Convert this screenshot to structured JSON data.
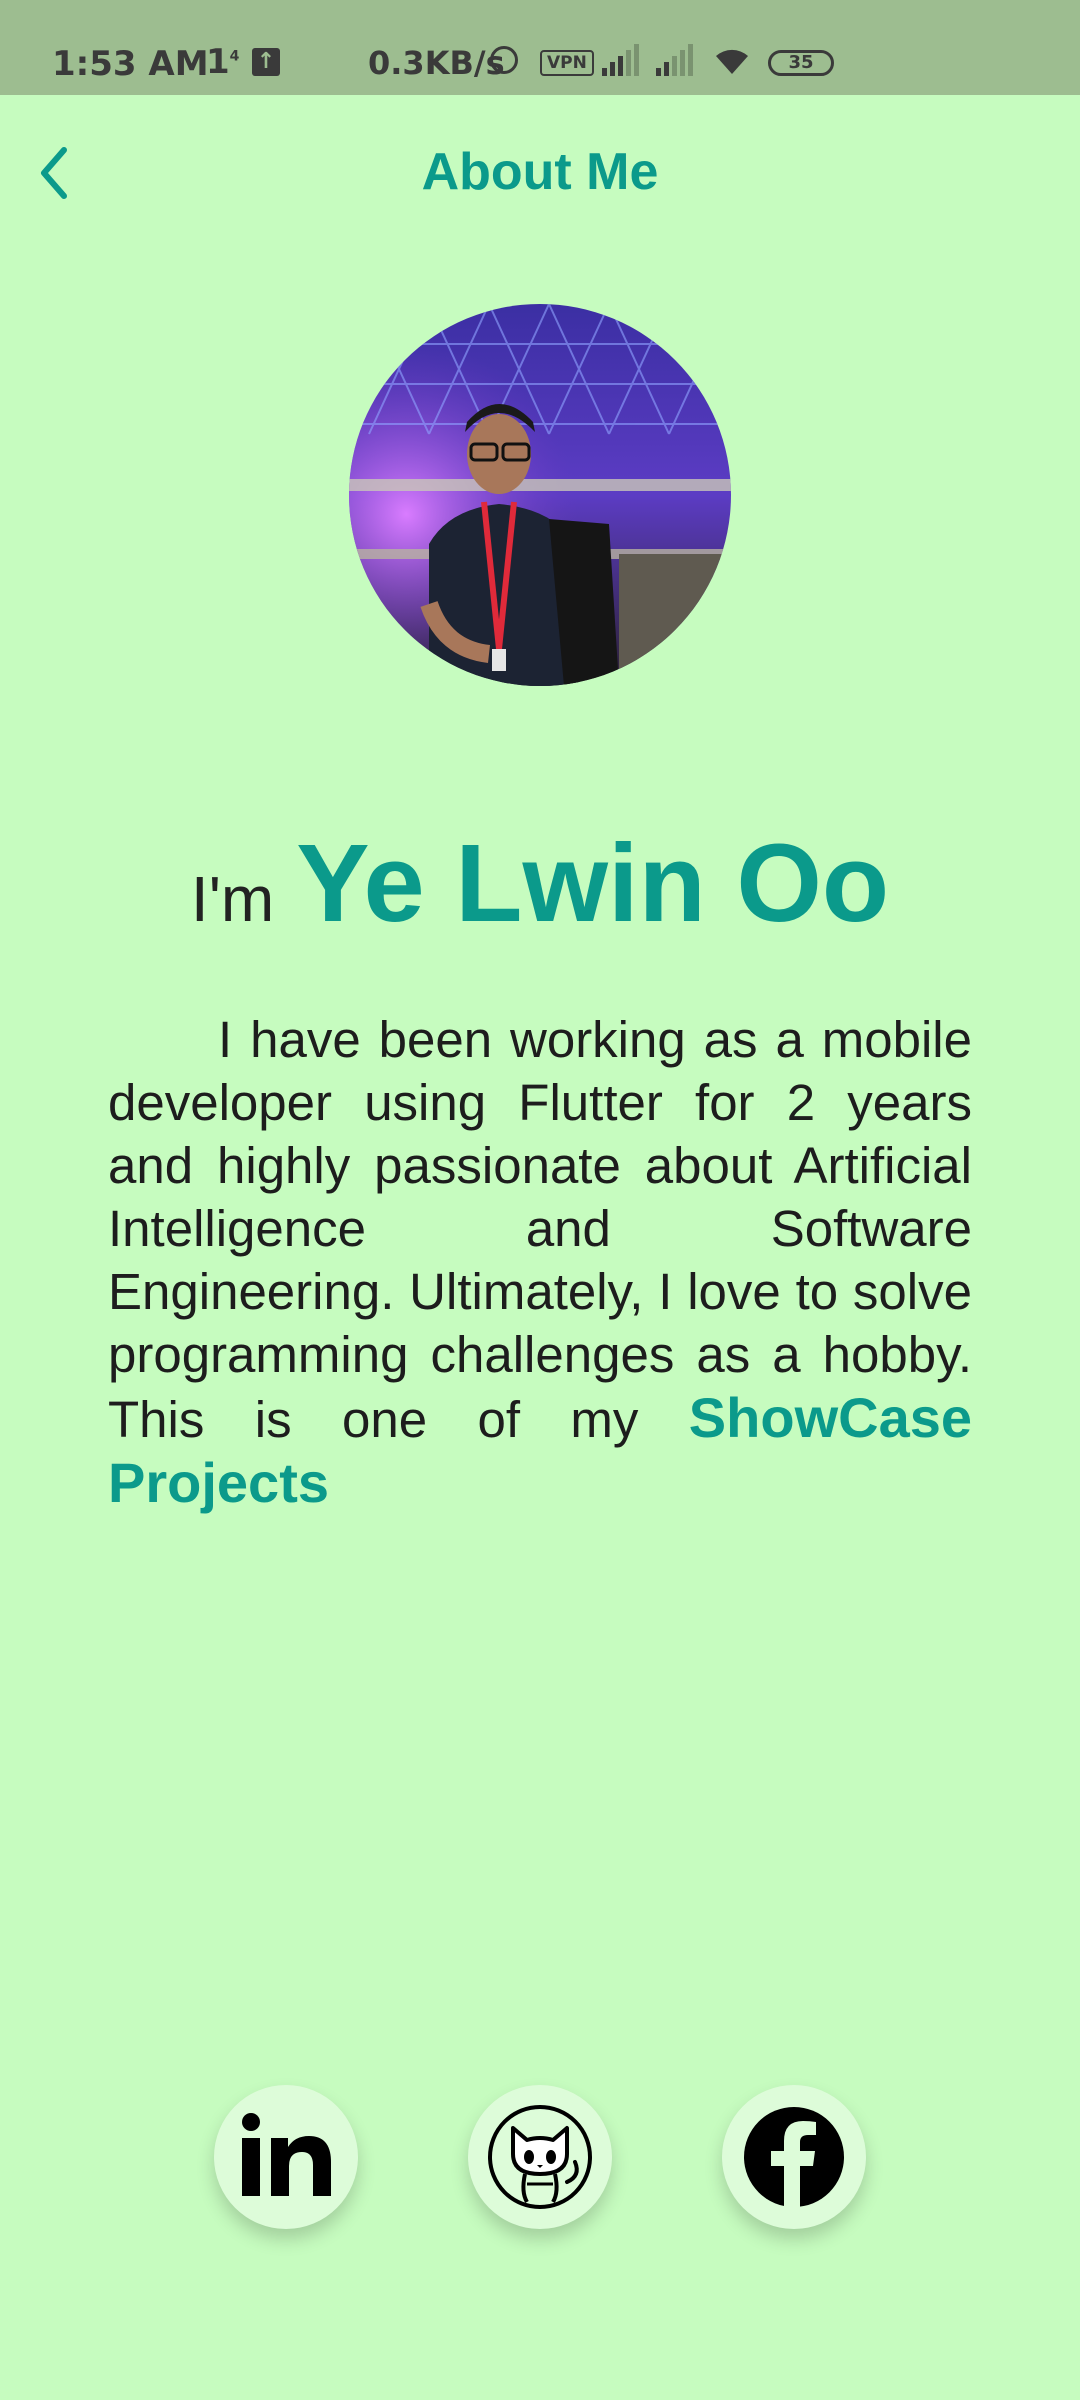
{
  "status_bar": {
    "time": "1:53 AM",
    "sim": "1",
    "sim_sup": "4",
    "network_speed": "0.3KB/s",
    "vpn_label": "VPN",
    "battery": "35"
  },
  "app_bar": {
    "title": "About Me",
    "back_icon": "chevron-left-icon"
  },
  "profile": {
    "greeting": "I'm",
    "name": "Ye Lwin Oo",
    "bio": "I have been working as a mobile developer using Flutter for 2 years and highly passionate about Artificial Intelligence and Software Engineering. Ultimately, I love to solve programming challenges as a hobby. This is one of my",
    "bio_link": "ShowCase Projects"
  },
  "social": [
    {
      "name": "linkedin",
      "icon": "linkedin-icon"
    },
    {
      "name": "github",
      "icon": "github-cat-icon"
    },
    {
      "name": "facebook",
      "icon": "facebook-icon"
    }
  ],
  "colors": {
    "background": "#c6fcbf",
    "status_bar": "#9dbd90",
    "accent": "#0b9a8b",
    "social_button": "#ddfcd9"
  }
}
